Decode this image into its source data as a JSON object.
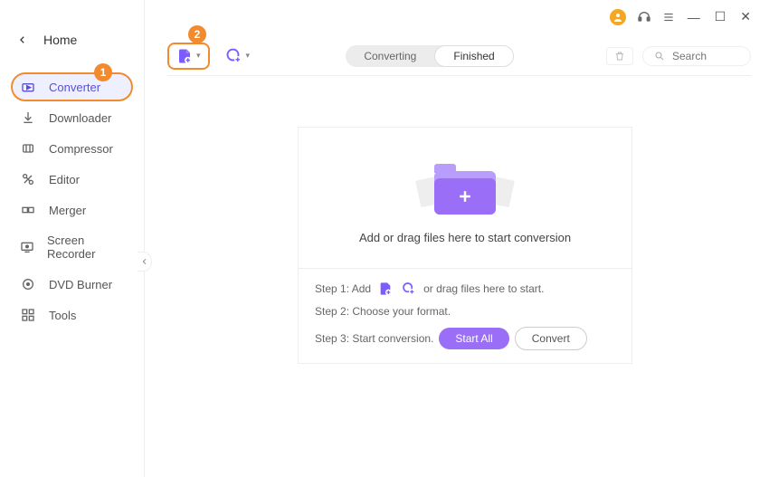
{
  "titlebar": {
    "min": "—",
    "max": "☐",
    "close": "✕"
  },
  "home": {
    "label": "Home"
  },
  "nav": {
    "items": [
      {
        "label": "Converter"
      },
      {
        "label": "Downloader"
      },
      {
        "label": "Compressor"
      },
      {
        "label": "Editor"
      },
      {
        "label": "Merger"
      },
      {
        "label": "Screen Recorder"
      },
      {
        "label": "DVD Burner"
      },
      {
        "label": "Tools"
      }
    ]
  },
  "badges": {
    "one": "1",
    "two": "2"
  },
  "tabs": {
    "converting": "Converting",
    "finished": "Finished"
  },
  "search": {
    "placeholder": "Search"
  },
  "drop": {
    "headline": "Add or drag files here to start conversion"
  },
  "steps": {
    "s1a": "Step 1: Add",
    "s1b": "or drag files here to start.",
    "s2": "Step 2: Choose your format.",
    "s3": "Step 3: Start conversion."
  },
  "buttons": {
    "start_all": "Start All",
    "convert": "Convert"
  }
}
